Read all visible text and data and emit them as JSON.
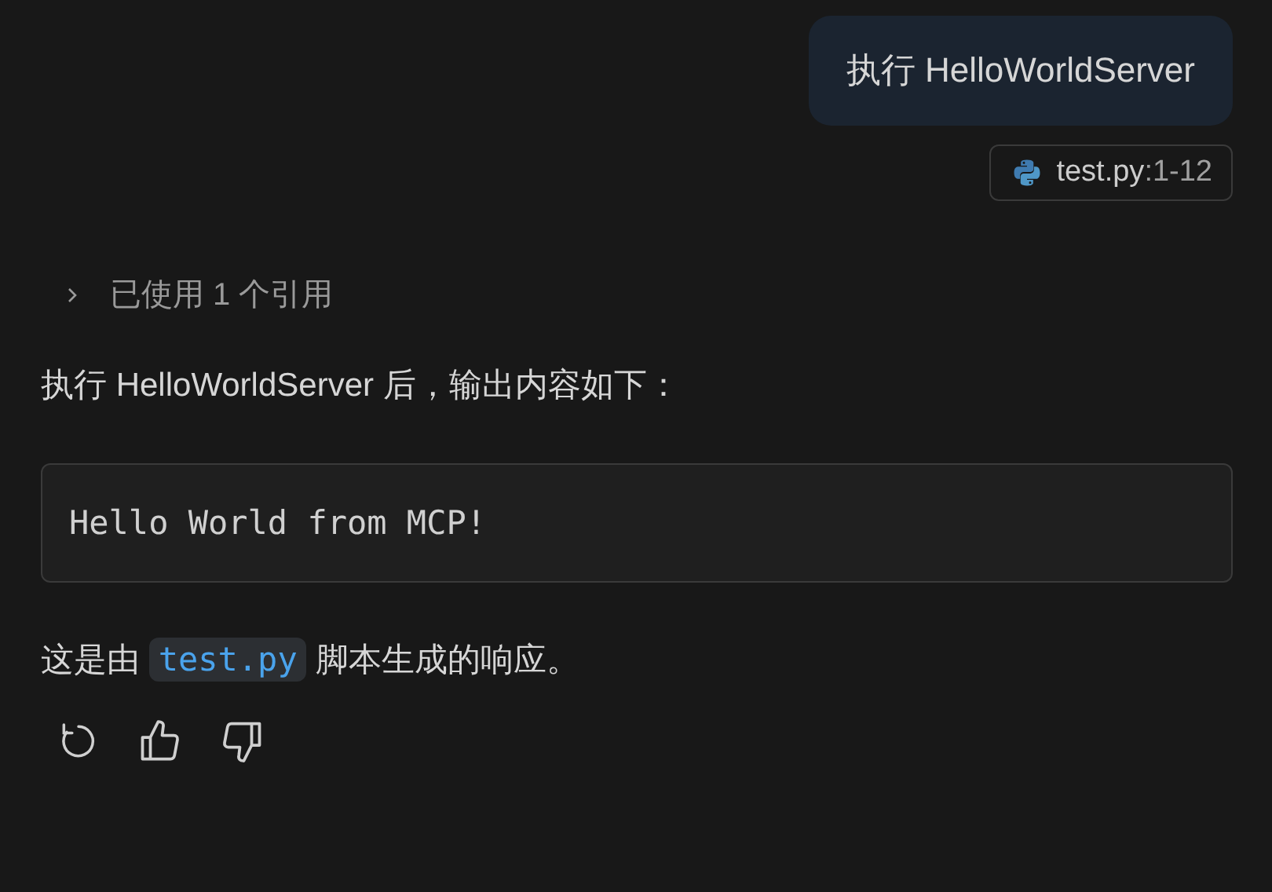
{
  "user_message": {
    "text": "执行 HelloWorldServer"
  },
  "attachment": {
    "file": "test.py",
    "range": ":1-12"
  },
  "references": {
    "label": "已使用 1 个引用",
    "expanded": false
  },
  "response": {
    "intro": "执行 HelloWorldServer 后，输出内容如下：",
    "code_block": "Hello World from MCP!",
    "closing": {
      "before": "这是由 ",
      "code": "test.py",
      "after": " 脚本生成的响应。"
    }
  },
  "actions": [
    {
      "kind": "retry"
    },
    {
      "kind": "like"
    },
    {
      "kind": "dislike"
    }
  ]
}
